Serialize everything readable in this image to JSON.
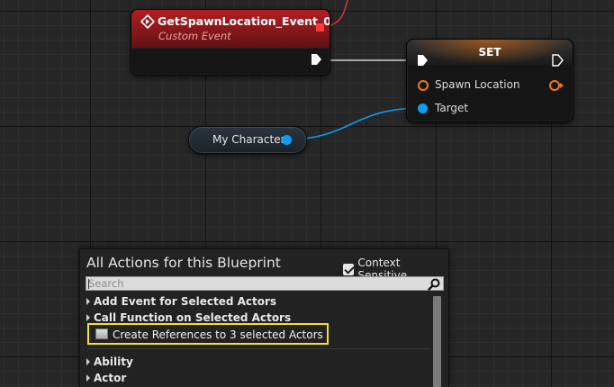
{
  "event_node": {
    "title": "GetSpawnLocation_Event_0",
    "subtitle": "Custom Event"
  },
  "set_node": {
    "title": "SET",
    "pins": [
      {
        "label": "Spawn Location"
      },
      {
        "label": "Target"
      }
    ]
  },
  "getter_node": {
    "label": "My Character"
  },
  "action_menu": {
    "title": "All Actions for this Blueprint",
    "context_sensitive_label": "Context Sensitive",
    "context_sensitive_checked": true,
    "search_placeholder": "Search",
    "items": [
      {
        "label": "Add Event for Selected Actors"
      },
      {
        "label": "Call Function on Selected Actors"
      },
      {
        "label": "Create References to 3 selected Actors"
      },
      {
        "label": "Ability"
      },
      {
        "label": "Actor"
      }
    ]
  },
  "colors": {
    "event_header": "#b31e22",
    "vector_pin": "#f3771e",
    "object_pin": "#0a9ff0",
    "highlight": "#f2e22c"
  }
}
